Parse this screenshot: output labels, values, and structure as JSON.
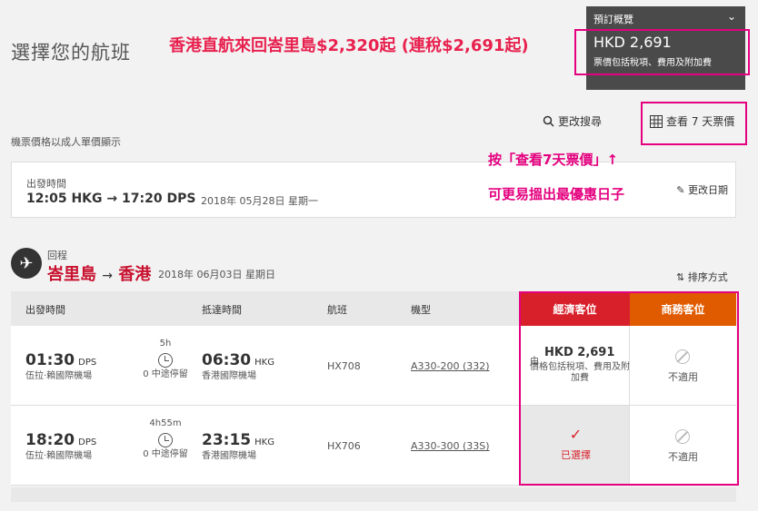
{
  "page": {
    "title": "選擇您的航班"
  },
  "annotations": {
    "top": "香港直航來回峇里島$2,320起 (連稅$2,691起)",
    "mid1": "按「查看7天票價」↑",
    "mid2": "可更易搵出最優惠日子"
  },
  "summary": {
    "header": "預訂概覽",
    "price": "HKD 2,691",
    "note": "票價包括稅項、費用及附加費"
  },
  "toolbar": {
    "modify_search": "更改搜尋",
    "view_7days": "查看 7 天票價"
  },
  "hint": "機票價格以成人單價顯示",
  "outbound": {
    "label": "出發時間",
    "from_time": "12:05",
    "from_code": "HKG",
    "to_time": "17:20",
    "to_code": "DPS",
    "date": "2018年 05月28日 星期一",
    "edit": "更改日期"
  },
  "return_leg": {
    "label": "回程",
    "origin": "峇里島",
    "destination": "香港",
    "date": "2018年 06月03日 星期日",
    "sort": "排序方式"
  },
  "table": {
    "headers": {
      "depart": "出發時間",
      "arrive": "抵達時間",
      "flight": "航班",
      "aircraft": "機型",
      "economy": "經濟客位",
      "business": "商務客位"
    },
    "rows": [
      {
        "dep_time": "01:30",
        "dep_code": "DPS",
        "dep_airport": "伍拉·賴國際機場",
        "duration": "5h",
        "stops": "0 中途停留",
        "arr_time": "06:30",
        "arr_code": "HKG",
        "arr_airport": "香港國際機場",
        "flight": "HX708",
        "aircraft": "A330-200 (332)",
        "eco_from": "由",
        "eco_price": "HKD 2,691",
        "eco_note": "價格包括稅項、費用及附加費",
        "biz": "不適用"
      },
      {
        "dep_time": "18:20",
        "dep_code": "DPS",
        "dep_airport": "伍拉·賴國際機場",
        "duration": "4h55m",
        "stops": "0 中途停留",
        "arr_time": "23:15",
        "arr_code": "HKG",
        "arr_airport": "香港國際機場",
        "flight": "HX706",
        "aircraft": "A330-300 (33S)",
        "eco_selected": "已選擇",
        "biz": "不適用"
      }
    ]
  },
  "colors": {
    "accent_red": "#d8202b",
    "business_orange": "#e05a00",
    "annotation_pink": "#e4007f"
  }
}
